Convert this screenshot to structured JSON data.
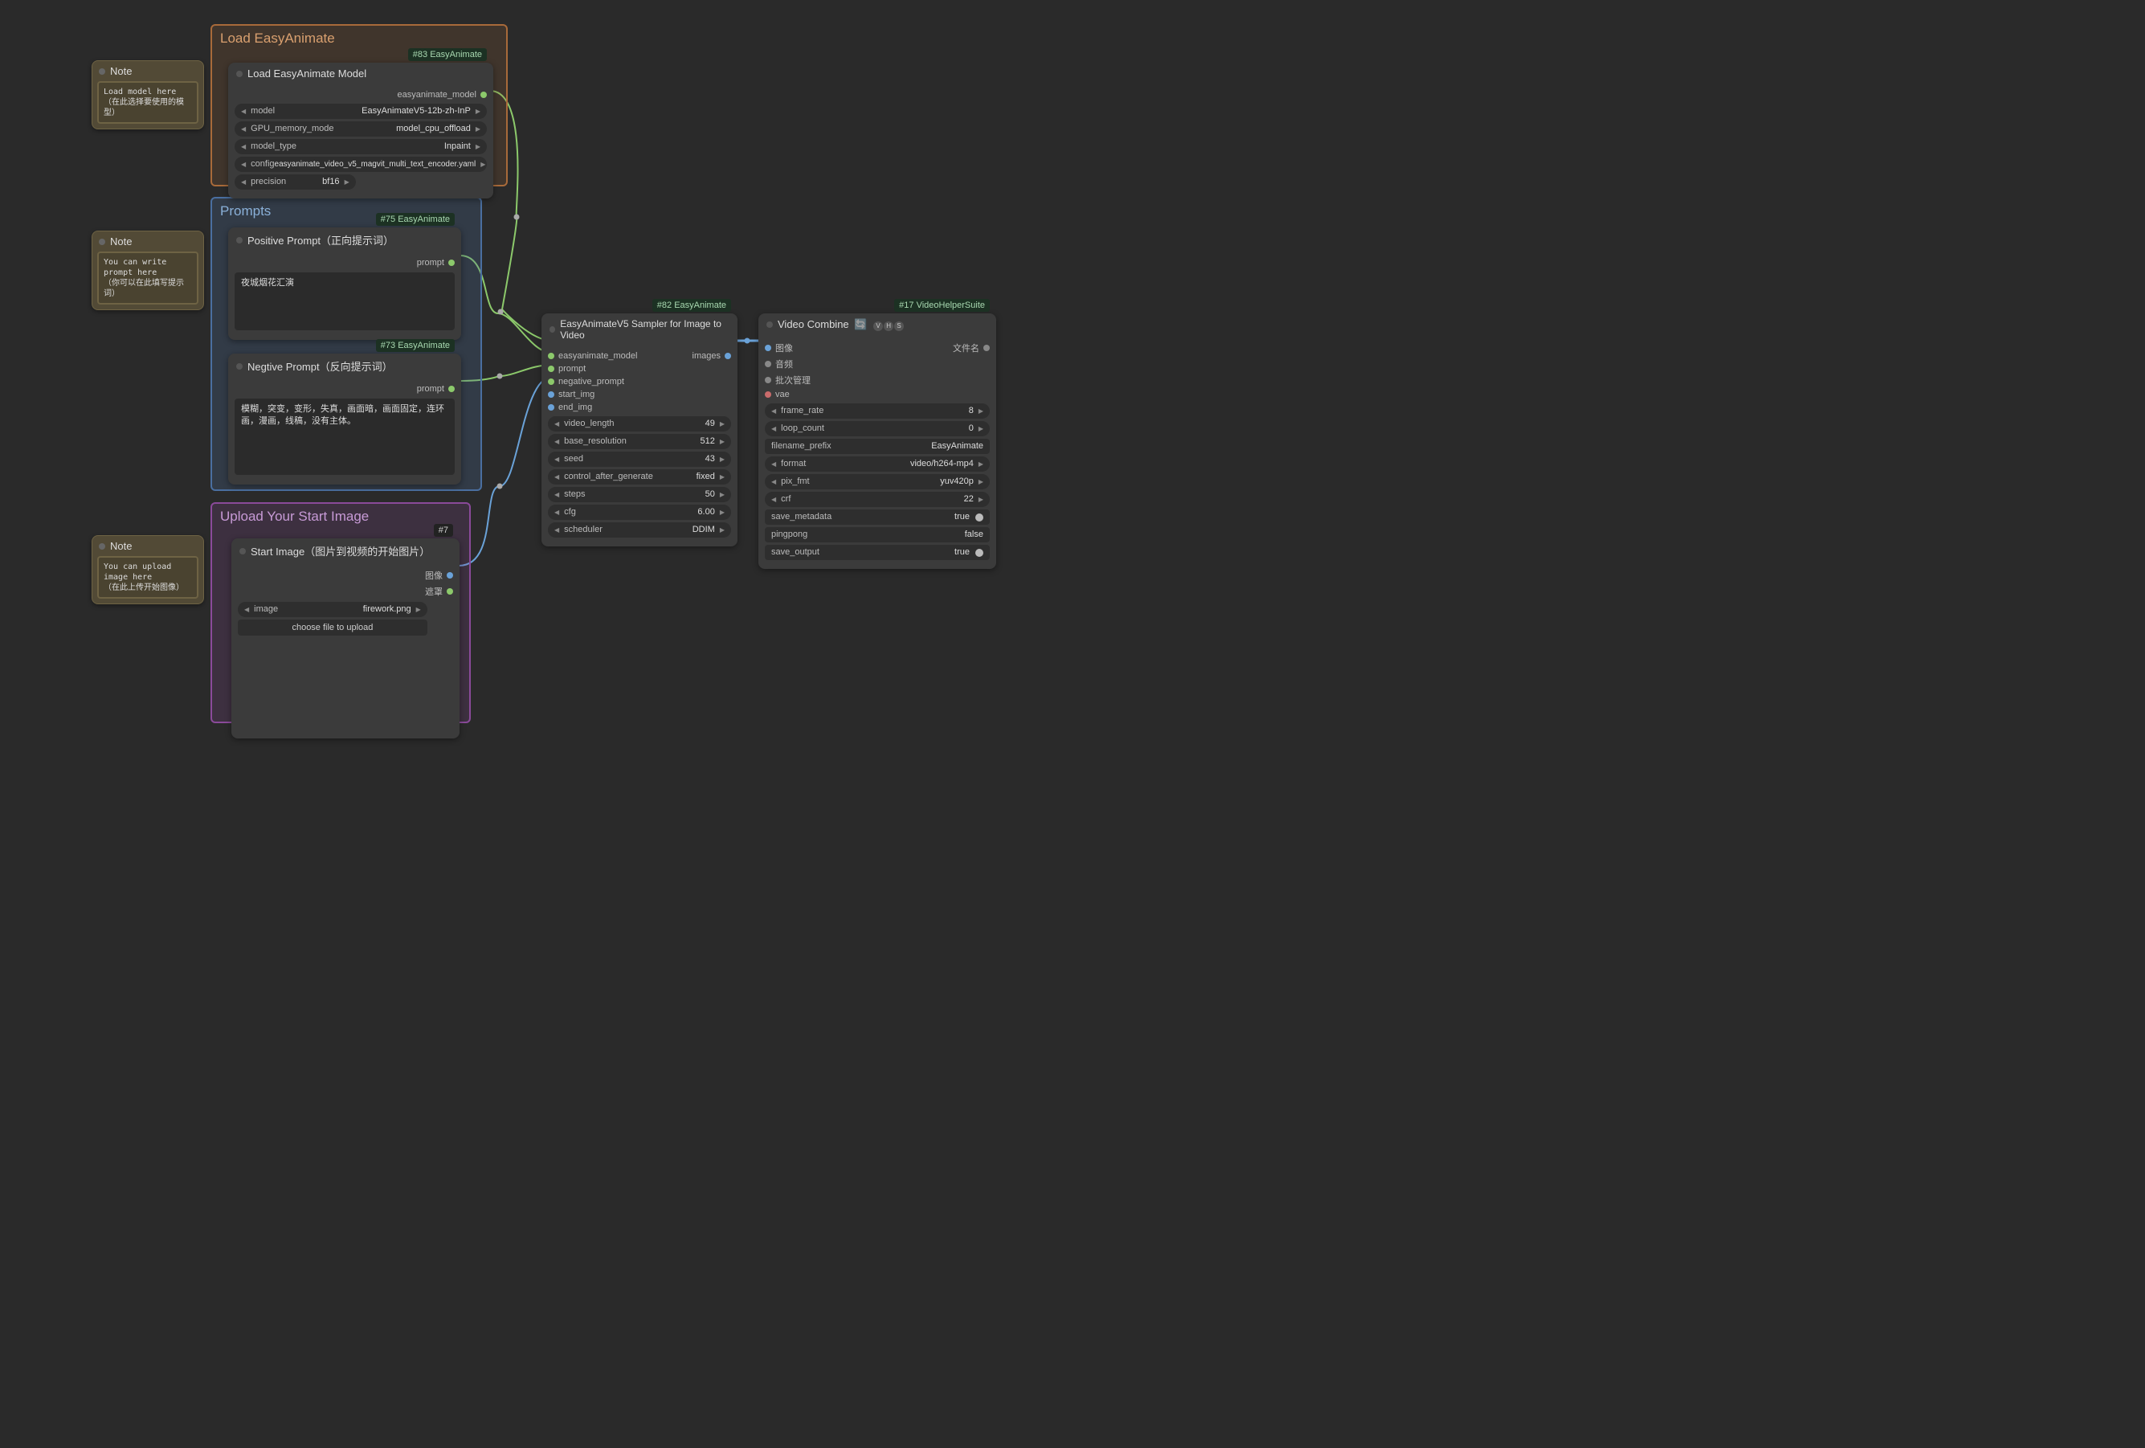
{
  "groups": {
    "load": {
      "title": "Load EasyAnimate",
      "color_border": "#a86a3a",
      "color_bg": "rgba(168,106,58,0.18)",
      "title_color": "#d9a06f"
    },
    "prompts": {
      "title": "Prompts",
      "color_border": "#4a6fa0",
      "color_bg": "rgba(74,111,160,0.25)",
      "title_color": "#8ab0d8"
    },
    "upload": {
      "title": "Upload Your Start Image",
      "color_border": "#8a4a9a",
      "color_bg": "rgba(138,74,154,0.20)",
      "title_color": "#c79ad6"
    }
  },
  "notes": {
    "load": {
      "title": "Note",
      "line1": "Load model here",
      "line2": "（在此选择要使用的模型）"
    },
    "prompt": {
      "title": "Note",
      "line1": "You can write prompt here",
      "line2": "（你可以在此填写提示词）"
    },
    "upload": {
      "title": "Note",
      "line1": "You can upload image here",
      "line2": "（在此上传开始图像）"
    }
  },
  "load_model": {
    "badge": "#83 EasyAnimate",
    "title": "Load EasyAnimate Model",
    "out_port": "easyanimate_model",
    "widgets": {
      "model": {
        "label": "model",
        "value": "EasyAnimateV5-12b-zh-InP"
      },
      "gpu": {
        "label": "GPU_memory_mode",
        "value": "model_cpu_offload"
      },
      "model_type": {
        "label": "model_type",
        "value": "Inpaint"
      },
      "config": {
        "label": "config",
        "value": "easyanimate_video_v5_magvit_multi_text_encoder.yaml"
      },
      "precision": {
        "label": "precision",
        "value": "bf16"
      }
    }
  },
  "pos_prompt": {
    "badge": "#75 EasyAnimate",
    "title": "Positive Prompt（正向提示词）",
    "out_port": "prompt",
    "text": "夜城烟花汇演"
  },
  "neg_prompt": {
    "badge": "#73 EasyAnimate",
    "title": "Negtive Prompt（反向提示词）",
    "out_port": "prompt",
    "text": "模糊，突变，变形，失真，画面暗，画面固定，连环画，漫画，线稿，没有主体。"
  },
  "start_image": {
    "badge": "#7",
    "title": "Start Image（图片到视频的开始图片）",
    "out1": "图像",
    "out2": "遮罩",
    "widget_image": {
      "label": "image",
      "value": "firework.png"
    },
    "upload_label": "choose file to upload"
  },
  "sampler": {
    "badge": "#82 EasyAnimate",
    "title": "EasyAnimateV5 Sampler for Image to Video",
    "in_ports": {
      "model": "easyanimate_model",
      "prompt": "prompt",
      "neg": "negative_prompt",
      "start": "start_img",
      "end": "end_img"
    },
    "out_port": "images",
    "widgets": {
      "video_length": {
        "label": "video_length",
        "value": "49"
      },
      "base_resolution": {
        "label": "base_resolution",
        "value": "512"
      },
      "seed": {
        "label": "seed",
        "value": "43"
      },
      "control_after_generate": {
        "label": "control_after_generate",
        "value": "fixed"
      },
      "steps": {
        "label": "steps",
        "value": "50"
      },
      "cfg": {
        "label": "cfg",
        "value": "6.00"
      },
      "scheduler": {
        "label": "scheduler",
        "value": "DDIM"
      }
    }
  },
  "video_combine": {
    "badge": "#17 VideoHelperSuite",
    "title": "Video Combine",
    "vhs": [
      "V",
      "H",
      "S"
    ],
    "in_ports": {
      "images": "图像",
      "audio": "音频",
      "batch": "批次管理",
      "vae": "vae"
    },
    "out_port": "文件名",
    "widgets": {
      "frame_rate": {
        "label": "frame_rate",
        "value": "8"
      },
      "loop_count": {
        "label": "loop_count",
        "value": "0"
      },
      "filename_prefix": {
        "label": "filename_prefix",
        "value": "EasyAnimate"
      },
      "format": {
        "label": "format",
        "value": "video/h264-mp4"
      },
      "pix_fmt": {
        "label": "pix_fmt",
        "value": "yuv420p"
      },
      "crf": {
        "label": "crf",
        "value": "22"
      },
      "save_metadata": {
        "label": "save_metadata",
        "value": "true"
      },
      "pingpong": {
        "label": "pingpong",
        "value": "false"
      },
      "save_output": {
        "label": "save_output",
        "value": "true"
      }
    }
  }
}
